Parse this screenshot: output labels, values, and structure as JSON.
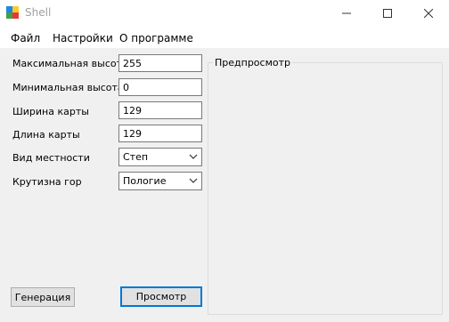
{
  "window": {
    "title": "Shell"
  },
  "menu": [
    "Файл",
    "Настройки",
    "О программе"
  ],
  "fields": {
    "max_height": {
      "label": "Максимальная высота",
      "value": "255"
    },
    "min_height": {
      "label": "Минимальная высота",
      "value": "0"
    },
    "map_width": {
      "label": "Ширина карты",
      "value": "129"
    },
    "map_length": {
      "label": "Длина карты",
      "value": "129"
    }
  },
  "combos": {
    "terrain": {
      "label": "Вид местности",
      "value": "Степ"
    },
    "steepness": {
      "label": "Крутизна гор",
      "value": "Пологие"
    }
  },
  "preview": {
    "title": "Предпросмотр"
  },
  "buttons": {
    "generate": "Генерация",
    "view": "Просмотр"
  },
  "icons": {
    "app": "app-window-icon",
    "minimize": "minimize-icon",
    "maximize": "maximize-icon",
    "close": "close-icon",
    "dropdown": "chevron-down-icon"
  }
}
